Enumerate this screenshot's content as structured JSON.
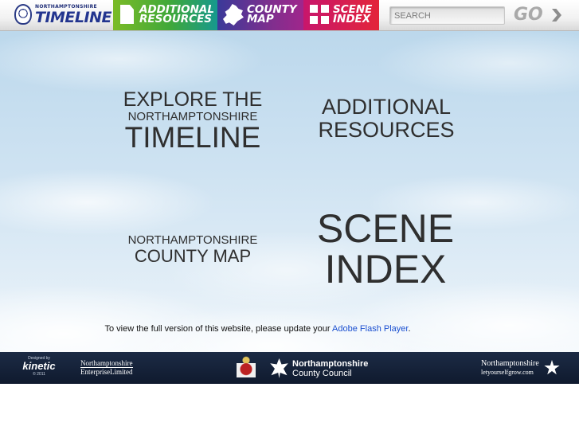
{
  "header": {
    "logo": {
      "top": "NORTHAMPTONSHIRE",
      "main": "TIMELINE"
    },
    "tabs": [
      {
        "line1": "ADDITIONAL",
        "line2": "RESOURCES",
        "icon": "document-icon",
        "color": "#3fa83a"
      },
      {
        "line1": "COUNTY",
        "line2": "MAP",
        "icon": "county-map-icon",
        "color": "#7d2f8e"
      },
      {
        "line1": "SCENE",
        "line2": "INDEX",
        "icon": "grid-icon",
        "color": "#e3253a"
      }
    ],
    "search": {
      "placeholder": "SEARCH",
      "value": ""
    },
    "go_label": "GO"
  },
  "main": {
    "timeline": {
      "line1": "EXPLORE THE",
      "line2": "NORTHAMPTONSHIRE",
      "line3": "TIMELINE"
    },
    "resources": {
      "line1": "ADDITIONAL",
      "line2": "RESOURCES"
    },
    "county_map": {
      "line1": "NORTHAMPTONSHIRE",
      "line2": "COUNTY MAP"
    },
    "scene_index": {
      "line1": "SCENE",
      "line2": "INDEX"
    },
    "flash_notice": {
      "text": "To view the full version of this website, please update your ",
      "link": "Adobe Flash Player",
      "suffix": "."
    }
  },
  "footer": {
    "designed_by": "Designed by",
    "kinetic": "kinetic",
    "copyright": "© 2011",
    "nel_line1": "Northamptonshire",
    "nel_line2": "EnterpriseLimited",
    "ncc_line1": "Northamptonshire",
    "ncc_line2": "County Council",
    "nlyg_line1": "Northamptonshire",
    "nlyg_line2": "letyourselfgrow.com"
  }
}
